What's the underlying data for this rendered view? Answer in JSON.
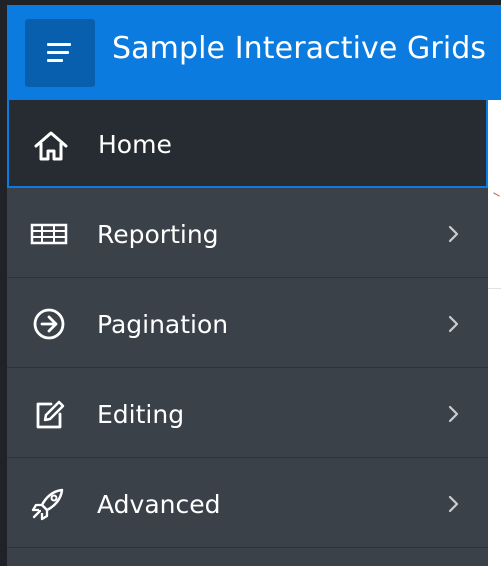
{
  "header": {
    "title": "Sample Interactive Grids",
    "menu_icon": "hamburger-menu-icon"
  },
  "nav": {
    "items": [
      {
        "label": "Home",
        "icon": "home-icon",
        "has_submenu": false,
        "current": true
      },
      {
        "label": "Reporting",
        "icon": "table-icon",
        "has_submenu": true,
        "current": false
      },
      {
        "label": "Pagination",
        "icon": "arrow-circle-right-icon",
        "has_submenu": true,
        "current": false
      },
      {
        "label": "Editing",
        "icon": "edit-icon",
        "has_submenu": true,
        "current": false
      },
      {
        "label": "Advanced",
        "icon": "rocket-icon",
        "has_submenu": true,
        "current": false
      }
    ]
  },
  "colors": {
    "header": "#0b7be0",
    "nav_background": "#3a4148",
    "nav_current": "#262c31",
    "accent": "#0b7be0"
  }
}
